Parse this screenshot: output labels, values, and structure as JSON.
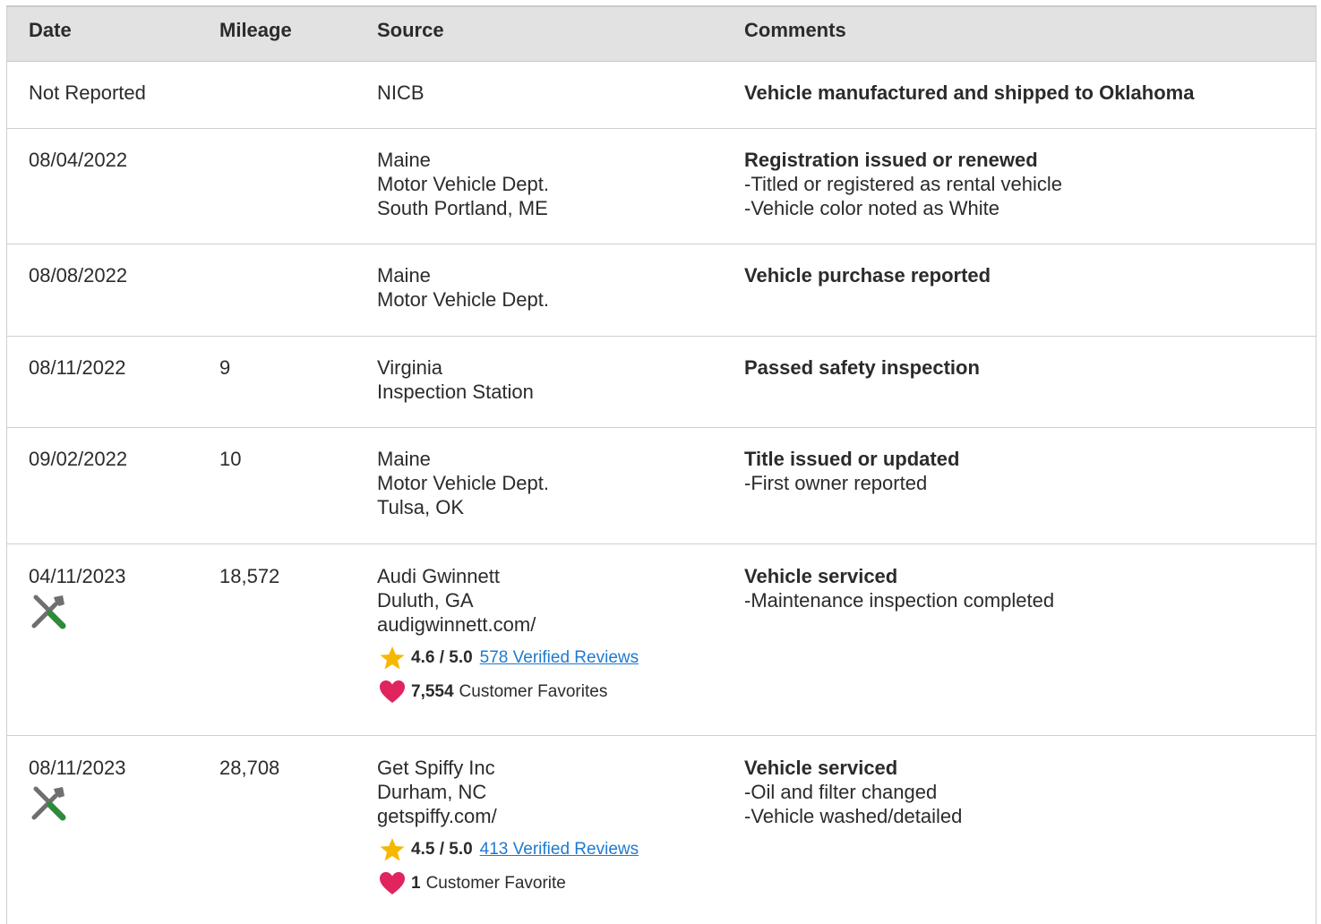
{
  "headers": {
    "date": "Date",
    "mileage": "Mileage",
    "source": "Source",
    "comments": "Comments"
  },
  "rows": [
    {
      "date": "Not Reported",
      "mileage": "",
      "source": [
        "NICB"
      ],
      "comment_title": "Vehicle manufactured and shipped to Oklahoma",
      "comment_items": []
    },
    {
      "date": "08/04/2022",
      "mileage": "",
      "source": [
        "Maine",
        "Motor Vehicle Dept.",
        "South Portland, ME"
      ],
      "comment_title": "Registration issued or renewed",
      "comment_items": [
        "Titled or registered as rental vehicle",
        "Vehicle color noted as White"
      ]
    },
    {
      "date": "08/08/2022",
      "mileage": "",
      "source": [
        "Maine",
        "Motor Vehicle Dept."
      ],
      "comment_title": "Vehicle purchase reported",
      "comment_items": []
    },
    {
      "date": "08/11/2022",
      "mileage": "9",
      "source": [
        "Virginia",
        "Inspection Station"
      ],
      "comment_title": "Passed safety inspection",
      "comment_items": []
    },
    {
      "date": "09/02/2022",
      "mileage": "10",
      "source": [
        "Maine",
        "Motor Vehicle Dept.",
        "Tulsa, OK"
      ],
      "comment_title": "Title issued or updated",
      "comment_items": [
        "First owner reported"
      ]
    },
    {
      "date": "04/11/2023",
      "mileage": "18,572",
      "icon": "service-tools-icon",
      "source": [
        "Audi Gwinnett",
        "Duluth, GA",
        "audigwinnett.com/"
      ],
      "rating": "4.6 / 5.0",
      "reviews": "578 Verified Reviews",
      "favorites_count": "7,554",
      "favorites_label": "Customer Favorites",
      "comment_title": "Vehicle serviced",
      "comment_items": [
        "Maintenance inspection completed"
      ]
    },
    {
      "date": "08/11/2023",
      "mileage": "28,708",
      "icon": "service-tools-icon",
      "source": [
        "Get Spiffy Inc",
        "Durham, NC",
        "getspiffy.com/"
      ],
      "rating": "4.5 / 5.0",
      "reviews": "413 Verified Reviews",
      "favorites_count": "1",
      "favorites_label": "Customer Favorite",
      "comment_title": "Vehicle serviced",
      "comment_items": [
        "Oil and filter changed",
        "Vehicle washed/detailed"
      ]
    }
  ],
  "colors": {
    "header_bg": "#e2e2e2",
    "link": "#1f7ad1",
    "star": "#f5b800",
    "heart": "#e0245e",
    "wrench_green": "#2e8b3a",
    "tool_gray": "#6f6f6f"
  }
}
